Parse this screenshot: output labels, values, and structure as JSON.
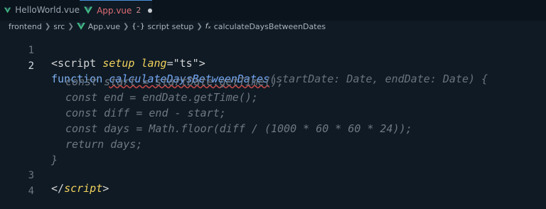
{
  "tabs": [
    {
      "label": "HelloWorld.vue",
      "active": false
    },
    {
      "label": "App.vue",
      "badge": "2",
      "active": true,
      "dirty": true
    }
  ],
  "breadcrumb": {
    "items": [
      "frontend",
      "src",
      "App.vue",
      "script setup",
      "calculateDaysBetweenDates"
    ]
  },
  "editor": {
    "lines": [
      {
        "number": "1",
        "open": "<",
        "tag": "script",
        "attr1": "setup",
        "attr2": "lang",
        "eq": "=",
        "value": "\"ts\"",
        "close": ">"
      },
      {
        "number": "2",
        "keyword": "function",
        "name": "calculateDaysBetweenDates",
        "params": "(startDate: Date, endDate: Date) {"
      },
      {
        "text": "const start = startDate.getTime();"
      },
      {
        "text": "const end = endDate.getTime();"
      },
      {
        "text": "const diff = end - start;"
      },
      {
        "text": "const days = Math.floor(diff / (1000 * 60 * 60 * 24));"
      },
      {
        "text": "return days;"
      },
      {
        "text": "}"
      },
      {
        "number": "3",
        "open": "</",
        "tag": "script",
        "close": ">"
      },
      {
        "number": "4"
      }
    ]
  },
  "colors": {
    "editor_bg": "#0f1a24",
    "keyword": "#7fb0f0",
    "attribute": "#f2d25c",
    "ghost_text": "#6f7882",
    "error_underline": "#c94a4a",
    "vue_green": "#41b883"
  }
}
